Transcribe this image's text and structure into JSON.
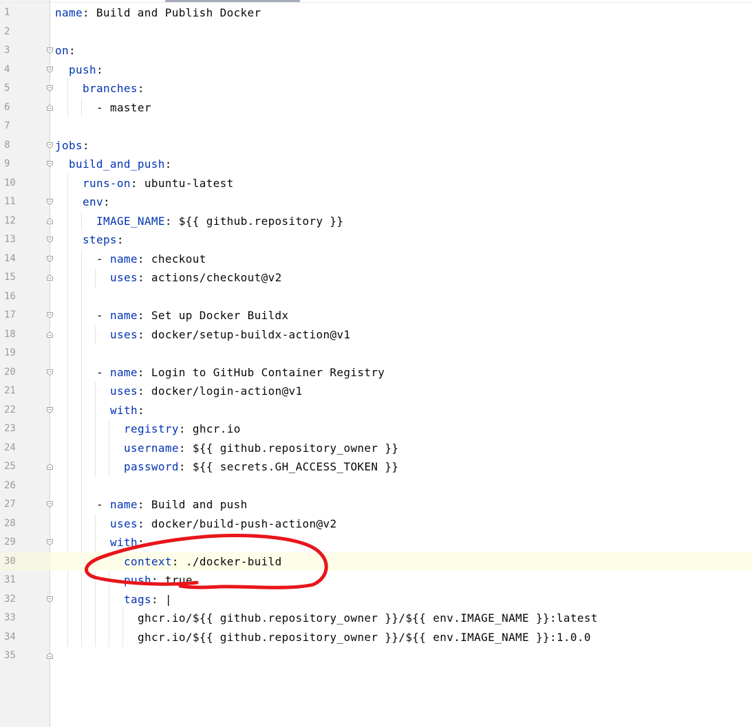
{
  "editor": {
    "current_line": 30,
    "lines": [
      {
        "n": "1",
        "indent": 0,
        "key": "name",
        "val": ": Build and Publish Docker",
        "fold": ""
      },
      {
        "n": "2",
        "indent": 0,
        "key": "",
        "val": "",
        "fold": ""
      },
      {
        "n": "3",
        "indent": 0,
        "key": "on",
        "val": ":",
        "fold": "open"
      },
      {
        "n": "4",
        "indent": 1,
        "key": "push",
        "val": ":",
        "fold": "open"
      },
      {
        "n": "5",
        "indent": 2,
        "key": "branches",
        "val": ":",
        "fold": "open"
      },
      {
        "n": "6",
        "indent": 3,
        "key": "",
        "val": "- master",
        "fold": "close"
      },
      {
        "n": "7",
        "indent": 0,
        "key": "",
        "val": "",
        "fold": ""
      },
      {
        "n": "8",
        "indent": 0,
        "key": "jobs",
        "val": ":",
        "fold": "open"
      },
      {
        "n": "9",
        "indent": 1,
        "key": "build_and_push",
        "val": ":",
        "fold": "open"
      },
      {
        "n": "10",
        "indent": 2,
        "key": "runs-on",
        "val": ": ubuntu-latest",
        "fold": ""
      },
      {
        "n": "11",
        "indent": 2,
        "key": "env",
        "val": ":",
        "fold": "open"
      },
      {
        "n": "12",
        "indent": 3,
        "key": "IMAGE_NAME",
        "val": ": ${{ github.repository }}",
        "fold": "close"
      },
      {
        "n": "13",
        "indent": 2,
        "key": "steps",
        "val": ":",
        "fold": "open"
      },
      {
        "n": "14",
        "indent": 3,
        "key": "name",
        "dash": true,
        "val": ": checkout",
        "fold": "open"
      },
      {
        "n": "15",
        "indent": 4,
        "key": "uses",
        "val": ": actions/checkout@v2",
        "fold": "close"
      },
      {
        "n": "16",
        "indent": 0,
        "key": "",
        "val": "",
        "fold": ""
      },
      {
        "n": "17",
        "indent": 3,
        "key": "name",
        "dash": true,
        "val": ": Set up Docker Buildx",
        "fold": "open"
      },
      {
        "n": "18",
        "indent": 4,
        "key": "uses",
        "val": ": docker/setup-buildx-action@v1",
        "fold": "close"
      },
      {
        "n": "19",
        "indent": 0,
        "key": "",
        "val": "",
        "fold": ""
      },
      {
        "n": "20",
        "indent": 3,
        "key": "name",
        "dash": true,
        "val": ": Login to GitHub Container Registry",
        "fold": "open"
      },
      {
        "n": "21",
        "indent": 4,
        "key": "uses",
        "val": ": docker/login-action@v1",
        "fold": ""
      },
      {
        "n": "22",
        "indent": 4,
        "key": "with",
        "val": ":",
        "fold": "open"
      },
      {
        "n": "23",
        "indent": 5,
        "key": "registry",
        "val": ": ghcr.io",
        "fold": ""
      },
      {
        "n": "24",
        "indent": 5,
        "key": "username",
        "val": ": ${{ github.repository_owner }}",
        "fold": ""
      },
      {
        "n": "25",
        "indent": 5,
        "key": "password",
        "val": ": ${{ secrets.GH_ACCESS_TOKEN }}",
        "fold": "close"
      },
      {
        "n": "26",
        "indent": 0,
        "key": "",
        "val": "",
        "fold": ""
      },
      {
        "n": "27",
        "indent": 3,
        "key": "name",
        "dash": true,
        "val": ": Build and push",
        "fold": "open"
      },
      {
        "n": "28",
        "indent": 4,
        "key": "uses",
        "val": ": docker/build-push-action@v2",
        "fold": ""
      },
      {
        "n": "29",
        "indent": 4,
        "key": "with",
        "val": ":",
        "fold": "open"
      },
      {
        "n": "30",
        "indent": 5,
        "key": "context",
        "val": ": ./docker-build",
        "fold": ""
      },
      {
        "n": "31",
        "indent": 5,
        "key": "push",
        "val": ": true",
        "fold": ""
      },
      {
        "n": "32",
        "indent": 5,
        "key": "tags",
        "val": ": |",
        "fold": "open"
      },
      {
        "n": "33",
        "indent": 6,
        "key": "",
        "val": "ghcr.io/${{ github.repository_owner }}/${{ env.IMAGE_NAME }}:latest",
        "fold": ""
      },
      {
        "n": "34",
        "indent": 6,
        "key": "",
        "val": "ghcr.io/${{ github.repository_owner }}/${{ env.IMAGE_NAME }}:1.0.0",
        "fold": ""
      },
      {
        "n": "35",
        "indent": 0,
        "key": "",
        "val": "",
        "fold": "close"
      }
    ]
  },
  "colors": {
    "key": "#0033b3",
    "text": "#080808",
    "line_number": "#9a9a9a",
    "gutter_bg": "#f2f2f2",
    "current_line_bg": "#fefde8",
    "annotation": "#e8151b"
  },
  "annotation": {
    "type": "hand-drawn-ellipse",
    "color": "#e8151b",
    "target_line": 30
  }
}
